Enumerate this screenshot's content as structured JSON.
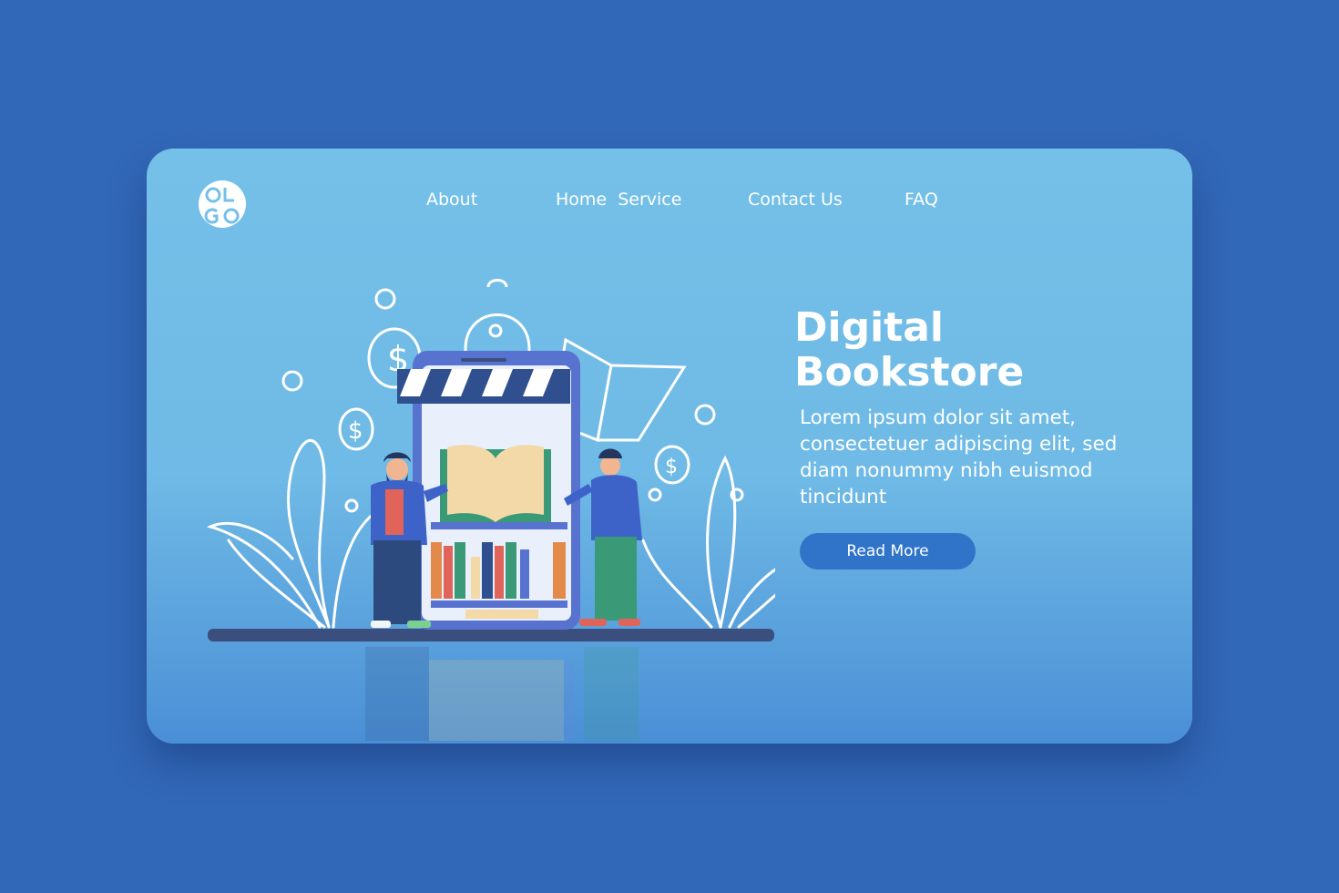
{
  "logo": {
    "text": "LOGO",
    "icon": "logo-icon"
  },
  "nav": {
    "about": "About",
    "home_service": "Home  Service",
    "contact": "Contact Us",
    "faq": "FAQ"
  },
  "hero": {
    "title_line1": "Digital",
    "title_line2": "Bookstore",
    "description": "Lorem ipsum dolor sit amet, consectetuer adipiscing elit, sed diam nonummy nibh euismod tincidunt",
    "cta_label": "Read More"
  },
  "colors": {
    "page_background": "#3268b8",
    "card_top": "#74c0e8",
    "card_bottom": "#4a8fd6",
    "button": "#2f74c9",
    "text": "#ffffff"
  }
}
